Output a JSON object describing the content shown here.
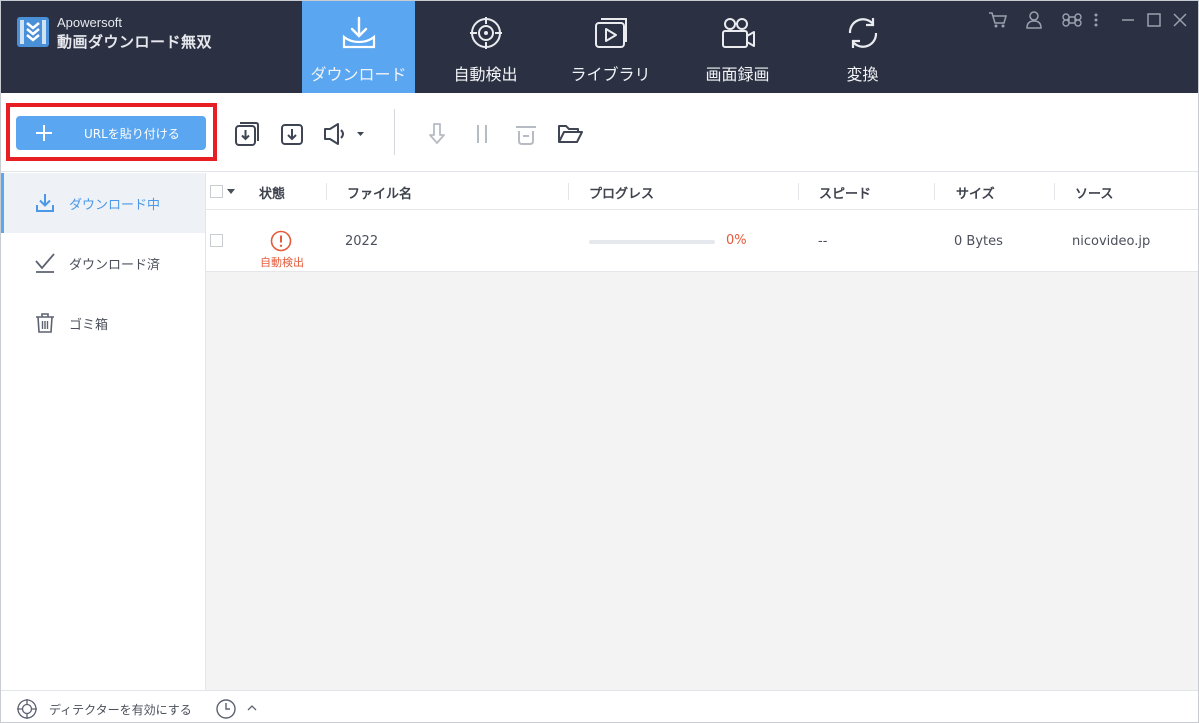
{
  "brand": {
    "company": "Apowersoft",
    "product": "動画ダウンロード無双"
  },
  "nav": [
    {
      "label": "ダウンロード",
      "icon": "download-tray-icon",
      "active": true
    },
    {
      "label": "自動検出",
      "icon": "target-icon",
      "active": false
    },
    {
      "label": "ライブラリ",
      "icon": "library-play-icon",
      "active": false
    },
    {
      "label": "画面録画",
      "icon": "video-camera-icon",
      "active": false
    },
    {
      "label": "変換",
      "icon": "convert-cycle-icon",
      "active": false
    }
  ],
  "window_controls": [
    "cart-icon",
    "user-icon",
    "command-icon",
    "more-icon",
    "minimize-icon",
    "maximize-icon",
    "close-icon"
  ],
  "toolbar": {
    "paste_label": "URLを貼り付ける",
    "icons": [
      "batch-download-icon",
      "download-box-icon",
      "speaker-icon",
      "resume-icon",
      "pause-icon",
      "delete-icon",
      "open-folder-icon"
    ]
  },
  "sidebar": {
    "items": [
      {
        "label": "ダウンロード中",
        "icon": "downloading-icon",
        "active": true
      },
      {
        "label": "ダウンロード済",
        "icon": "downloaded-check-icon",
        "active": false
      },
      {
        "label": "ゴミ箱",
        "icon": "trash-icon",
        "active": false
      }
    ]
  },
  "table": {
    "headers": {
      "status": "状態",
      "filename": "ファイル名",
      "progress": "プログレス",
      "speed": "スピード",
      "size": "サイズ",
      "source": "ソース"
    },
    "rows": [
      {
        "status": "自動検出",
        "filename": "2022",
        "progress": 0,
        "progress_text": "0%",
        "speed": "--",
        "size": "0 Bytes",
        "source": "nicovideo.jp"
      }
    ]
  },
  "footer": {
    "detector_label": "ディテクターを有効にする"
  },
  "colors": {
    "accent": "#5aa6f0",
    "header_bg": "#2b3142",
    "error": "#e45a3b",
    "highlight": "#e81e25"
  }
}
